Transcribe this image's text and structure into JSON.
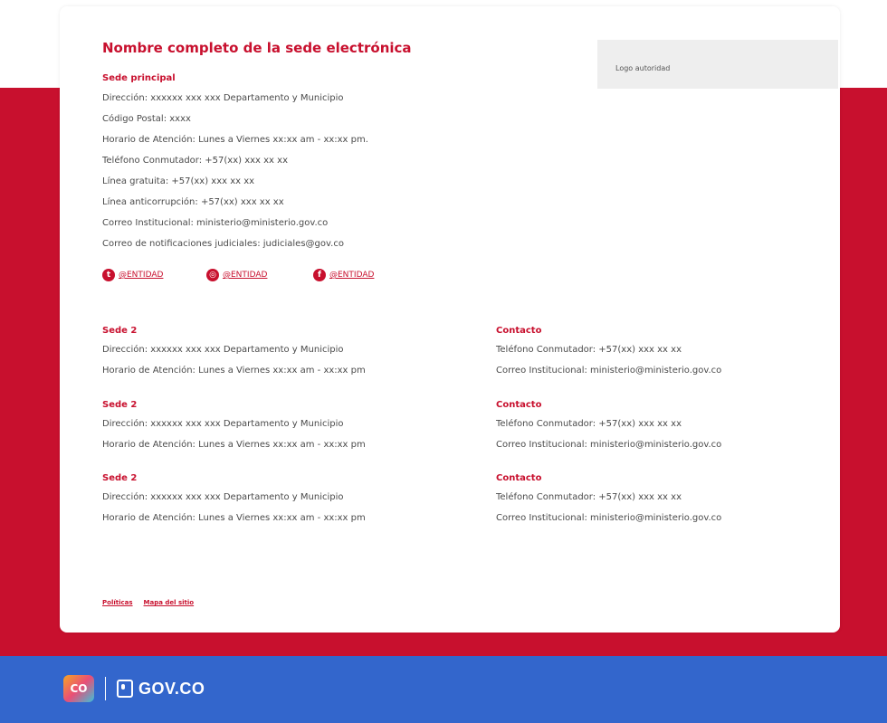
{
  "card": {
    "title": "Nombre completo de la sede electrónica",
    "logo_label": "Logo autoridad"
  },
  "main_office": {
    "heading": "Sede principal",
    "lines": [
      "Dirección: xxxxxx xxx xxx Departamento y Municipio",
      "Código Postal: xxxx",
      "Horario de Atención: Lunes a Viernes xx:xx am - xx:xx pm.",
      "Teléfono Conmutador: +57(xx) xxx xx xx",
      "Línea gratuita: +57(xx) xxx xx xx",
      "Línea anticorrupción: +57(xx) xxx xx xx",
      "Correo Institucional: ministerio@ministerio.gov.co",
      "Correo de notificaciones judiciales: judiciales@gov.co"
    ]
  },
  "social": [
    {
      "icon": "twitter-icon",
      "glyph": "t",
      "label": "@ENTIDAD"
    },
    {
      "icon": "instagram-icon",
      "glyph": "◎",
      "label": "@ENTIDAD"
    },
    {
      "icon": "facebook-icon",
      "glyph": "f",
      "label": "@ENTIDAD"
    }
  ],
  "sedes": [
    {
      "heading": "Sede 2",
      "address": "Dirección: xxxxxx xxx xxx Departamento y Municipio",
      "hours": "Horario de Atención: Lunes a Viernes xx:xx am - xx:xx pm",
      "contact_heading": "Contacto",
      "phone": "Teléfono Conmutador: +57(xx) xxx xx xx",
      "email": "Correo Institucional: ministerio@ministerio.gov.co"
    },
    {
      "heading": "Sede 2",
      "address": "Dirección: xxxxxx xxx xxx Departamento y Municipio",
      "hours": "Horario de Atención: Lunes a Viernes xx:xx am - xx:xx pm",
      "contact_heading": "Contacto",
      "phone": "Teléfono Conmutador: +57(xx) xxx xx xx",
      "email": "Correo Institucional: ministerio@ministerio.gov.co"
    },
    {
      "heading": "Sede 2",
      "address": "Dirección: xxxxxx xxx xxx Departamento y Municipio",
      "hours": "Horario de Atención: Lunes a Viernes xx:xx am - xx:xx pm",
      "contact_heading": "Contacto",
      "phone": "Teléfono Conmutador: +57(xx) xxx xx xx",
      "email": "Correo Institucional: ministerio@ministerio.gov.co"
    }
  ],
  "footer_links": [
    "Políticas",
    "Mapa del sitio"
  ],
  "govbar": {
    "co_logo": "CO",
    "gov_text": "GOV.CO"
  },
  "colors": {
    "accent": "#c8102e",
    "gov_blue": "#3366cc"
  }
}
